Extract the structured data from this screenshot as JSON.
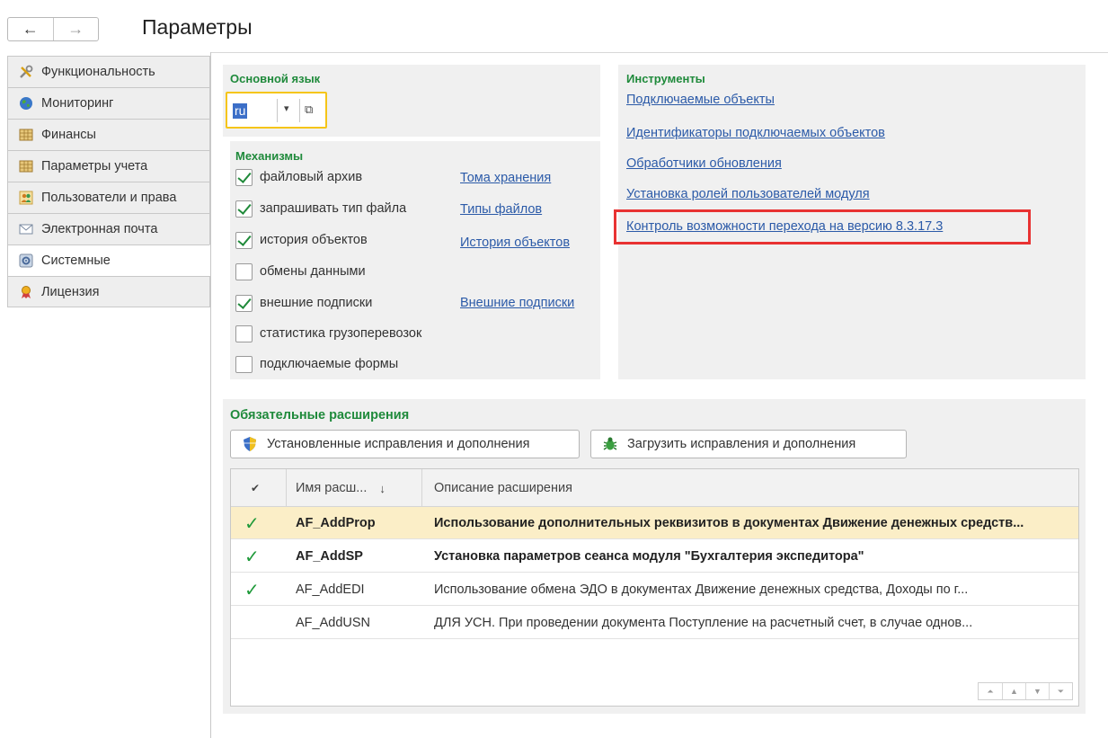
{
  "header": {
    "title": "Параметры",
    "back_glyph": "←",
    "forward_glyph": "→"
  },
  "sidebar": {
    "items": [
      {
        "label": "Функциональность",
        "icon": "tools-icon"
      },
      {
        "label": "Мониторинг",
        "icon": "globe-icon"
      },
      {
        "label": "Финансы",
        "icon": "ledger-icon"
      },
      {
        "label": "Параметры учета",
        "icon": "ledger-icon"
      },
      {
        "label": "Пользователи и права",
        "icon": "users-icon"
      },
      {
        "label": "Электронная почта",
        "icon": "mail-icon"
      },
      {
        "label": "Системные",
        "icon": "system-icon"
      },
      {
        "label": "Лицензия",
        "icon": "license-icon"
      }
    ],
    "active_index": 6
  },
  "language": {
    "title": "Основной язык",
    "value": "ru",
    "arrow_glyph": "▾",
    "open_glyph": "⧉"
  },
  "mechanisms": {
    "title": "Механизмы",
    "items": [
      {
        "label": "файловый архив",
        "checked": true,
        "link": "Тома хранения"
      },
      {
        "label": "запрашивать тип файла",
        "checked": true,
        "link": "Типы файлов"
      },
      {
        "label": "история объектов",
        "checked": true,
        "link": "История объектов"
      },
      {
        "label": "обмены данными",
        "checked": false,
        "link": ""
      },
      {
        "label": "внешние подписки",
        "checked": true,
        "link": "Внешние подписки"
      },
      {
        "label": "статистика грузоперевозок",
        "checked": false,
        "link": ""
      },
      {
        "label": "подключаемые формы",
        "checked": false,
        "link": ""
      }
    ]
  },
  "tools": {
    "title": "Инструменты",
    "links": [
      "Подключаемые объекты",
      "Идентификаторы подключаемых объектов",
      "Обработчики обновления",
      "Установка ролей пользователей модуля",
      "Контроль возможности перехода на версию 8.3.17.3"
    ],
    "highlighted_index": 4,
    "highlight_color": "#e83232"
  },
  "extensions": {
    "title": "Обязательные расширения",
    "buttons": {
      "installed": "Установленные исправления и дополнения",
      "load": "Загрузить исправления и дополнения"
    },
    "columns": {
      "check": "✔",
      "name": "Имя расш...",
      "sort_glyph": "↓",
      "description": "Описание расширения"
    },
    "rows": [
      {
        "checked": true,
        "name": "AF_AddProp",
        "description": "Использование дополнительных реквизитов в документах Движение денежных средств...",
        "bold": true,
        "selected": true
      },
      {
        "checked": true,
        "name": "AF_AddSP",
        "description": "Установка параметров сеанса модуля \"Бухгалтерия экспедитора\"",
        "bold": true,
        "selected": false
      },
      {
        "checked": true,
        "name": "AF_AddEDI",
        "description": "Использование обмена ЭДО в документах Движение денежных средства, Доходы по г...",
        "bold": false,
        "selected": false
      },
      {
        "checked": false,
        "name": "AF_AddUSN",
        "description": "ДЛЯ УСН. При проведении документа Поступление на расчетный счет, в случае однов...",
        "bold": false,
        "selected": false
      }
    ],
    "check_glyph": "✓",
    "pager": [
      "⏶",
      "▲",
      "▼",
      "⏷"
    ]
  },
  "colors": {
    "section_title": "#1f8a3b",
    "link": "#2b5aa8",
    "selected_row": "#fbeec7",
    "focus_border": "#f5c518"
  }
}
